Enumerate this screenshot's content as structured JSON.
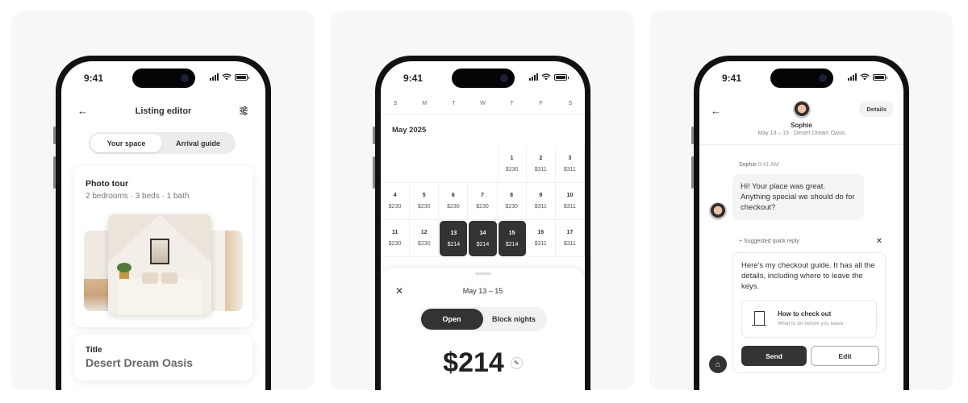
{
  "status_bar": {
    "time": "9:41"
  },
  "screen1": {
    "nav_title": "Listing editor",
    "back_icon": "←",
    "tabs": [
      {
        "label": "Your space",
        "active": true
      },
      {
        "label": "Arrival guide",
        "active": false
      }
    ],
    "photo_tour": {
      "title": "Photo tour",
      "subtitle": "2 bedrooms · 3 beds · 1 bath"
    },
    "title_field": {
      "label": "Title",
      "value": "Desert Dream Oasis"
    }
  },
  "screen2": {
    "weekdays": [
      "S",
      "M",
      "T",
      "W",
      "T",
      "F",
      "S"
    ],
    "month": "May 2025",
    "days": [
      {
        "day": "1",
        "price": "$230"
      },
      {
        "day": "2",
        "price": "$311"
      },
      {
        "day": "3",
        "price": "$311"
      },
      {
        "day": "4",
        "price": "$230"
      },
      {
        "day": "5",
        "price": "$230"
      },
      {
        "day": "6",
        "price": "$230"
      },
      {
        "day": "7",
        "price": "$230"
      },
      {
        "day": "8",
        "price": "$230"
      },
      {
        "day": "9",
        "price": "$311"
      },
      {
        "day": "10",
        "price": "$311"
      },
      {
        "day": "11",
        "price": "$230"
      },
      {
        "day": "12",
        "price": "$230"
      },
      {
        "day": "13",
        "price": "$214",
        "selected": true
      },
      {
        "day": "14",
        "price": "$214",
        "selected": true
      },
      {
        "day": "15",
        "price": "$214",
        "selected": true
      },
      {
        "day": "16",
        "price": "$311"
      },
      {
        "day": "17",
        "price": "$311"
      }
    ],
    "sheet": {
      "close_icon": "✕",
      "title": "May 13 – 15",
      "toggle": [
        {
          "label": "Open",
          "active": true
        },
        {
          "label": "Block nights",
          "active": false
        }
      ],
      "price": "$214",
      "edit_icon": "✎"
    }
  },
  "screen3": {
    "back_icon": "←",
    "guest_name": "Sophie",
    "trip_info": "May 13 – 15 · Desert Dream Oasis",
    "details_label": "Details",
    "message": {
      "sender": "Sophie",
      "time": "9:41 AM",
      "text": "Hi! Your place was great. Anything special we should do for checkout?"
    },
    "suggestion": {
      "label": "+ Suggested quick reply",
      "close_icon": "✕",
      "text": "Here's my checkout guide. It has all the details, including where to leave the keys.",
      "guide_title": "How to check out",
      "guide_subtitle": "What to do before you leave",
      "send_label": "Send",
      "edit_label": "Edit"
    },
    "host_icon": "⌂"
  }
}
